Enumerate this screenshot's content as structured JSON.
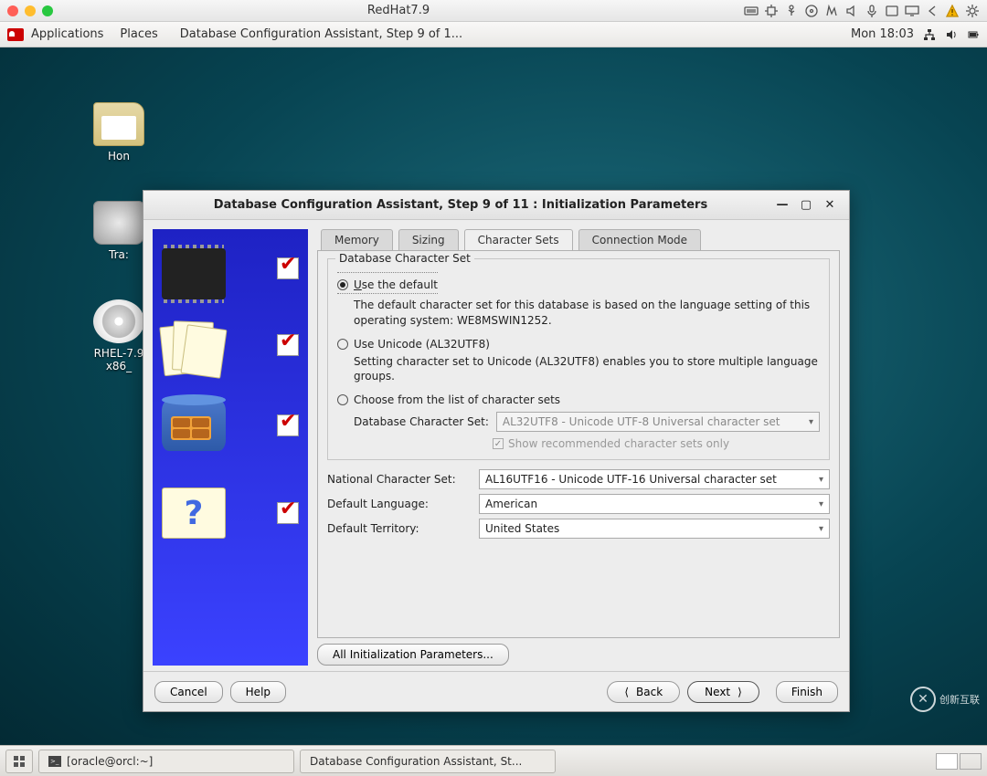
{
  "mac": {
    "title": "RedHat7.9"
  },
  "gnome": {
    "applications": "Applications",
    "places": "Places",
    "active_window": "Database Configuration Assistant, Step 9 of 1...",
    "clock": "Mon 18:03"
  },
  "desktop": {
    "icons": [
      {
        "name": "home-folder",
        "label": "Hon"
      },
      {
        "name": "trash",
        "label": "Tra:"
      },
      {
        "name": "rhel-disc",
        "label": "RHEL-7.9"
      },
      {
        "name": "rhel-disc-sub",
        "label": "x86_"
      }
    ]
  },
  "dialog": {
    "title": "Database Configuration Assistant, Step 9 of 11 : Initialization Parameters",
    "tabs": [
      "Memory",
      "Sizing",
      "Character Sets",
      "Connection Mode"
    ],
    "active_tab": "Character Sets",
    "group_legend": "Database Character Set",
    "opt_default": "Use the default",
    "opt_default_desc": "The default character set for this database is based on the language setting of this operating system: WE8MSWIN1252.",
    "opt_unicode": "Use Unicode (AL32UTF8)",
    "opt_unicode_desc": "Setting character set to Unicode (AL32UTF8) enables you to store multiple language groups.",
    "opt_choose": "Choose from the list of character sets",
    "db_charset_label": "Database Character Set:",
    "db_charset_value": "AL32UTF8 - Unicode UTF-8 Universal character set",
    "show_recommended": "Show recommended character sets only",
    "nat_charset_label": "National Character Set:",
    "nat_charset_value": "AL16UTF16 - Unicode UTF-16 Universal character set",
    "lang_label": "Default Language:",
    "lang_value": "American",
    "terr_label": "Default Territory:",
    "terr_value": "United States",
    "all_params": "All Initialization Parameters...",
    "cancel": "Cancel",
    "help": "Help",
    "back": "Back",
    "next": "Next",
    "finish": "Finish"
  },
  "taskbar": {
    "terminal": "[oracle@orcl:~]",
    "active_app": "Database Configuration Assistant, St..."
  },
  "watermark": {
    "text": "创新互联"
  }
}
